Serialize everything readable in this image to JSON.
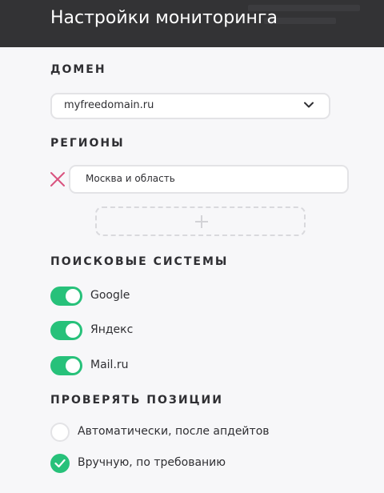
{
  "header": {
    "title": "Настройки мониторинга"
  },
  "domain": {
    "section_title": "ДОМЕН",
    "selected": "myfreedomain.ru"
  },
  "regions": {
    "section_title": "РЕГИОНЫ",
    "items": [
      "Москва и область"
    ]
  },
  "search_engines": {
    "section_title": "ПОИСКОВЫЕ СИСТЕМЫ",
    "items": [
      {
        "label": "Google",
        "enabled": true
      },
      {
        "label": "Яндекс",
        "enabled": true
      },
      {
        "label": "Mail.ru",
        "enabled": true
      }
    ]
  },
  "check_positions": {
    "section_title": "ПРОВЕРЯТЬ ПОЗИЦИИ",
    "options": [
      {
        "label": "Автоматически, после апдейтов",
        "selected": false
      },
      {
        "label": "Вручную, по требованию",
        "selected": true
      }
    ]
  },
  "colors": {
    "accent": "#27c17a",
    "header_bg": "#333335",
    "remove": "#d9537f"
  }
}
